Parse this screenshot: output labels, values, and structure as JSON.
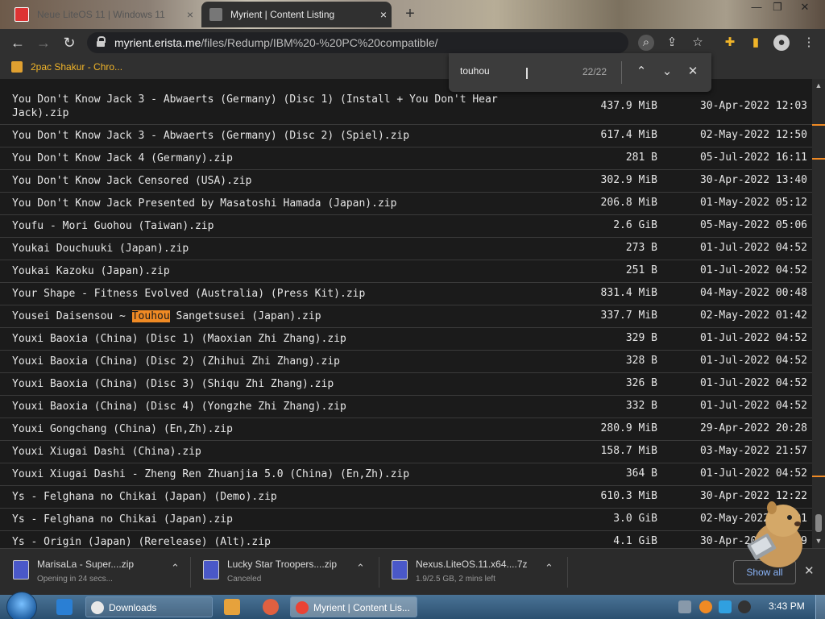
{
  "browser": {
    "tabs": [
      {
        "title": "Neue LiteOS 11 | Windows 11",
        "close": "×"
      },
      {
        "title": "Myrient | Content Listing",
        "close": "×"
      }
    ],
    "new_tab": "+",
    "window_controls": [
      "—",
      "❐",
      "✕"
    ],
    "url_host": "myrient.erista.me",
    "url_path": "/files/Redump/IBM%20-%20PC%20compatible/",
    "bookmark": "2pac Shakur - Chro..."
  },
  "find_bar": {
    "query": "touhou",
    "count": "22/22"
  },
  "listing": {
    "rows": [
      {
        "name": "You Don't Know Jack 3 - Abwaerts (Germany) (Disc 1) (Install + You Don't Hear Jack).zip",
        "size": "437.9 MiB",
        "date": "30-Apr-2022 12:03"
      },
      {
        "name": "You Don't Know Jack 3 - Abwaerts (Germany) (Disc 2) (Spiel).zip",
        "size": "617.4 MiB",
        "date": "02-May-2022 12:50"
      },
      {
        "name": "You Don't Know Jack 4 (Germany).zip",
        "size": "281 B",
        "date": "05-Jul-2022 16:11"
      },
      {
        "name": "You Don't Know Jack Censored (USA).zip",
        "size": "302.9 MiB",
        "date": "30-Apr-2022 13:40"
      },
      {
        "name": "You Don't Know Jack Presented by Masatoshi Hamada (Japan).zip",
        "size": "206.8 MiB",
        "date": "01-May-2022 05:12"
      },
      {
        "name": "Youfu - Mori Guohou (Taiwan).zip",
        "size": "2.6 GiB",
        "date": "05-May-2022 05:06"
      },
      {
        "name": "Youkai Douchuuki (Japan).zip",
        "size": "273 B",
        "date": "01-Jul-2022 04:52"
      },
      {
        "name": "Youkai Kazoku (Japan).zip",
        "size": "251 B",
        "date": "01-Jul-2022 04:52"
      },
      {
        "name": "Your Shape - Fitness Evolved (Australia) (Press Kit).zip",
        "size": "831.4 MiB",
        "date": "04-May-2022 00:48"
      },
      {
        "name_pre": "Yousei Daisensou ~ ",
        "name_hl": "Touhou",
        "name_post": " Sangetsusei (Japan).zip",
        "size": "337.7 MiB",
        "date": "02-May-2022 01:42"
      },
      {
        "name": "Youxi Baoxia (China) (Disc 1) (Maoxian Zhi Zhang).zip",
        "size": "329 B",
        "date": "01-Jul-2022 04:52"
      },
      {
        "name": "Youxi Baoxia (China) (Disc 2) (Zhihui Zhi Zhang).zip",
        "size": "328 B",
        "date": "01-Jul-2022 04:52"
      },
      {
        "name": "Youxi Baoxia (China) (Disc 3) (Shiqu Zhi Zhang).zip",
        "size": "326 B",
        "date": "01-Jul-2022 04:52"
      },
      {
        "name": "Youxi Baoxia (China) (Disc 4) (Yongzhe Zhi Zhang).zip",
        "size": "332 B",
        "date": "01-Jul-2022 04:52"
      },
      {
        "name": "Youxi Gongchang (China) (En,Zh).zip",
        "size": "280.9 MiB",
        "date": "29-Apr-2022 20:28"
      },
      {
        "name": "Youxi Xiugai Dashi (China).zip",
        "size": "158.7 MiB",
        "date": "03-May-2022 21:57"
      },
      {
        "name": "Youxi Xiugai Dashi - Zheng Ren Zhuanjia 5.0 (China) (En,Zh).zip",
        "size": "364 B",
        "date": "01-Jul-2022 04:52"
      },
      {
        "name": "Ys - Felghana no Chikai (Japan) (Demo).zip",
        "size": "610.3 MiB",
        "date": "30-Apr-2022 12:22"
      },
      {
        "name": "Ys - Felghana no Chikai (Japan).zip",
        "size": "3.0 GiB",
        "date": "02-May-2022 16:01"
      },
      {
        "name": "Ys - Origin (Japan) (Rerelease) (Alt).zip",
        "size": "4.1 GiB",
        "date": "30-Apr-2022 13:19"
      }
    ]
  },
  "downloads": [
    {
      "name": "MarisaLa - Super....zip",
      "status": "Opening in 24 secs..."
    },
    {
      "name": "Lucky Star Troopers....zip",
      "status": "Canceled"
    },
    {
      "name": "Nexus.LiteOS.11.x64....7z",
      "status": "1.9/2.5 GB, 2 mins left"
    }
  ],
  "downloads_show_all": "Show all",
  "taskbar": {
    "items": [
      "Downloads",
      "Myrient | Content Lis..."
    ],
    "clock": "3:43 PM"
  },
  "colors": {
    "highlight": "#f08a24",
    "bookmark_text": "#f0b429",
    "link": "#8ab4f8"
  }
}
